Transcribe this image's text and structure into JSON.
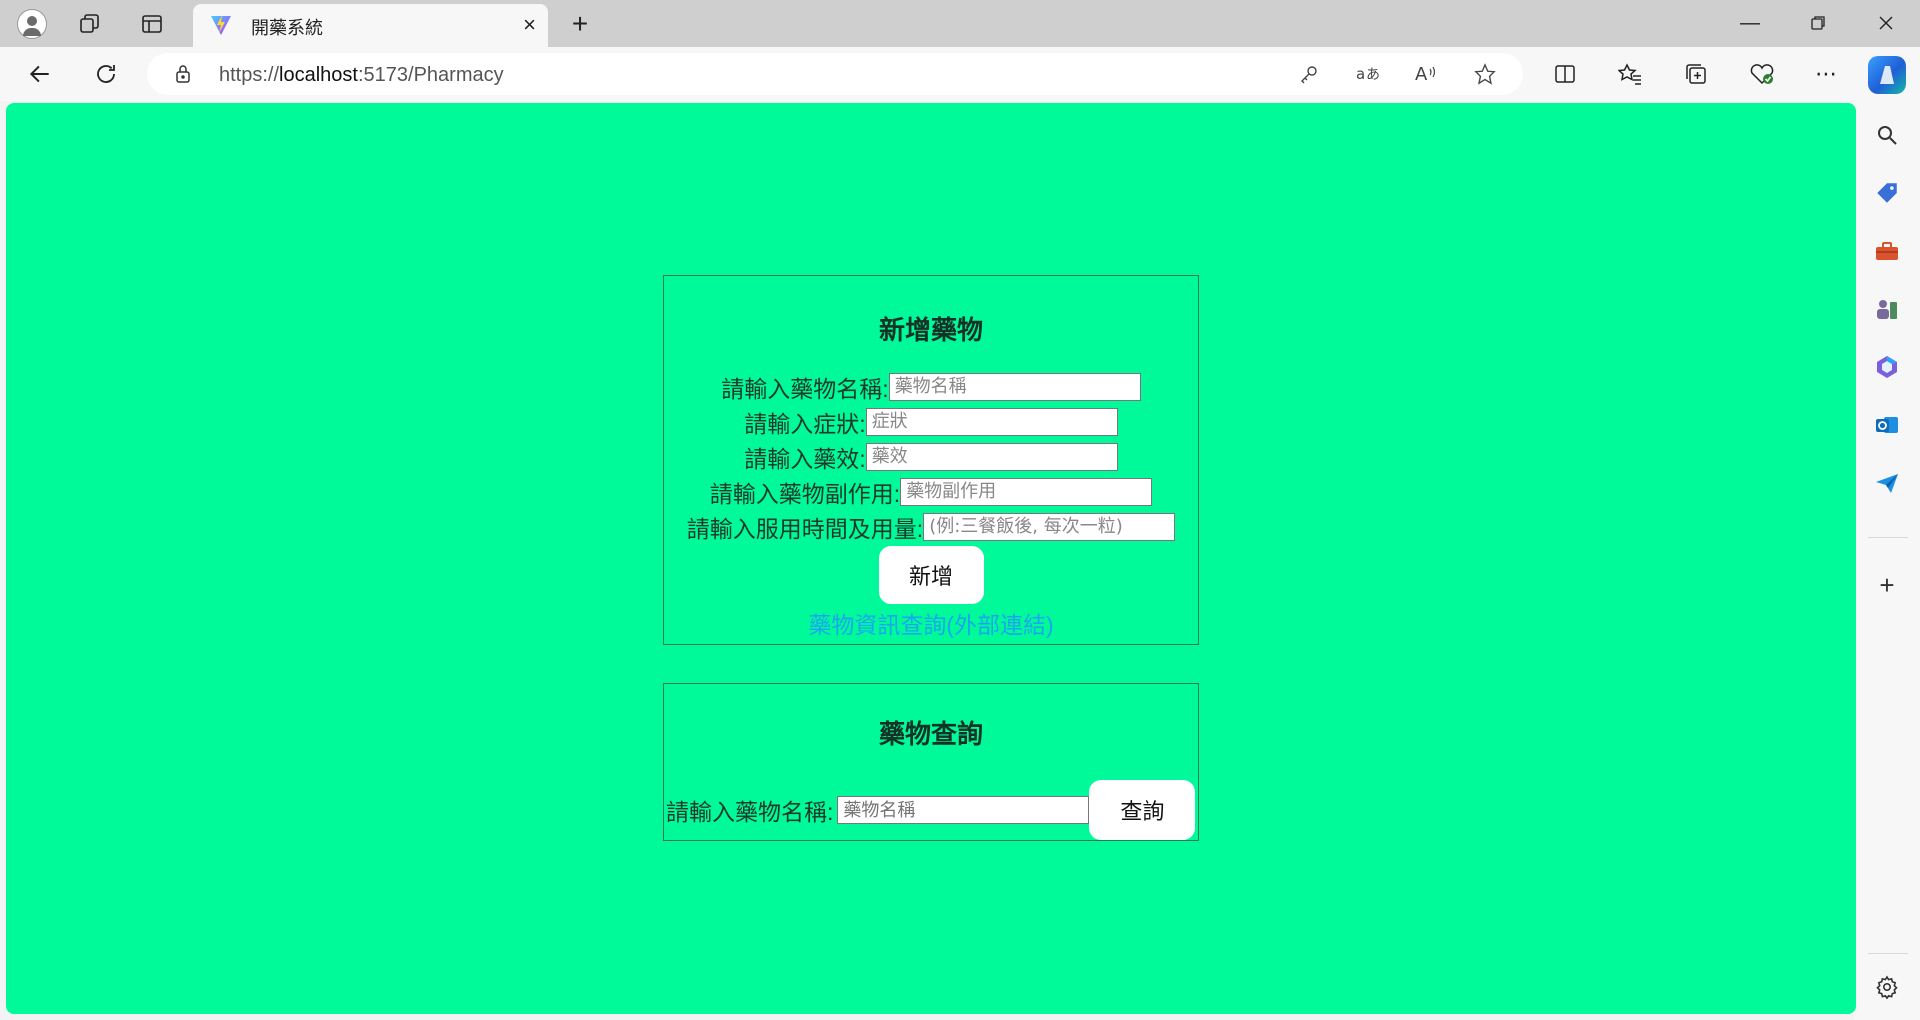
{
  "browser": {
    "tab_title": "開藥系統",
    "url_prefix": "https://",
    "url_host": "localhost",
    "url_path": ":5173/Pharmacy",
    "tab_close": "×",
    "new_tab": "+"
  },
  "add_section": {
    "title": "新增藥物",
    "fields": [
      {
        "label": "請輸入藥物名稱:",
        "placeholder": "藥物名稱"
      },
      {
        "label": "請輸入症狀:",
        "placeholder": "症狀"
      },
      {
        "label": "請輸入藥效:",
        "placeholder": "藥效"
      },
      {
        "label": "請輸入藥物副作用:",
        "placeholder": "藥物副作用"
      },
      {
        "label": "請輸入服用時間及用量:",
        "placeholder": "(例:三餐飯後, 每次一粒)"
      }
    ],
    "submit_label": "新增",
    "external_link": "藥物資訊查詢(外部連結)"
  },
  "query_section": {
    "title": "藥物查詢",
    "label": "請輸入藥物名稱:",
    "placeholder": "藥物名稱",
    "submit_label": "查詢"
  },
  "colors": {
    "page_background": "#00fa9a",
    "link": "#1aa7ee"
  },
  "icons": {
    "toolbar": [
      "back-icon",
      "refresh-icon",
      "lock-icon",
      "key-icon",
      "translate-icon",
      "read-aloud-icon",
      "favorite-star-icon",
      "split-screen-icon",
      "favorites-icon",
      "collections-icon",
      "browser-essentials-icon",
      "more-icon"
    ],
    "sidebar": [
      "search-icon",
      "shopping-tag-icon",
      "tools-icon",
      "games-icon",
      "microsoft365-icon",
      "outlook-icon",
      "send-icon",
      "add-icon",
      "settings-icon"
    ]
  }
}
